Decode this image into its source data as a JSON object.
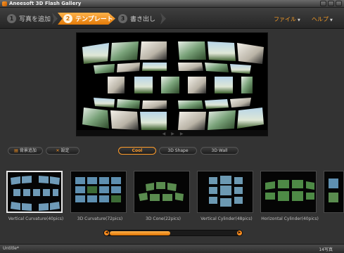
{
  "window": {
    "title": "Aneesoft 3D Flash Gallery"
  },
  "steps": [
    {
      "num": "1",
      "label": "写真を追加"
    },
    {
      "num": "2",
      "label": "テンプレート"
    },
    {
      "num": "3",
      "label": "書き出し"
    }
  ],
  "menu": {
    "file": "ファイル",
    "help": "ヘルプ"
  },
  "toolbar": {
    "background_label": "背景追加",
    "settings_label": "設定"
  },
  "categories": [
    "Cool",
    "3D Shape",
    "3D Wall"
  ],
  "selected_category": "Cool",
  "templates": [
    {
      "label": "Vertical Curvature(40pics)",
      "icon": "vertical-curvature-thumbnail",
      "selected": true
    },
    {
      "label": "3D Curvature(72pics)",
      "icon": "curvature-thumbnail"
    },
    {
      "label": "3D Cone(22pics)",
      "icon": "cone-thumbnail"
    },
    {
      "label": "Vertical Cylinder(48pics)",
      "icon": "vertical-cylinder-thumbnail"
    },
    {
      "label": "Horizontal Cylinder(40pics)",
      "icon": "horizontal-cylinder-thumbnail"
    }
  ],
  "status": {
    "document": "Untitle*",
    "photo_count": "14写真"
  },
  "colors": {
    "accent": "#f39a26",
    "background": "#333333"
  }
}
